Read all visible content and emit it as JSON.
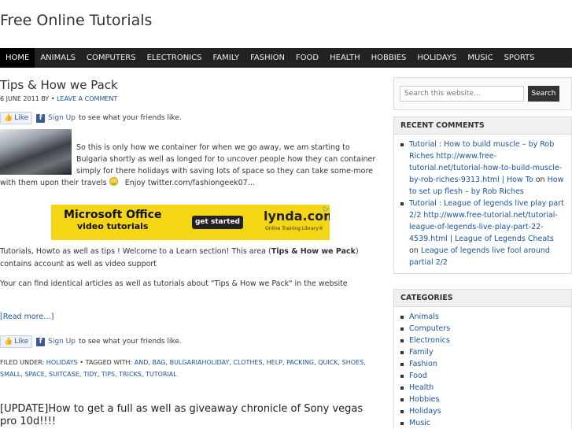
{
  "site": {
    "title": "Free Online Tutorials"
  },
  "nav": {
    "items": [
      "HOME",
      "ANIMALS",
      "COMPUTERS",
      "ELECTRONICS",
      "FAMILY",
      "FASHION",
      "FOOD",
      "HEALTH",
      "HOBBIES",
      "HOLIDAYS",
      "MUSIC",
      "SPORTS"
    ],
    "active_index": 0
  },
  "post": {
    "title": "Tips & How we Pack",
    "date": "6 June 2011",
    "by": "by",
    "author": "•",
    "leave_comment": "Leave a Comment",
    "fb": {
      "like": "Like",
      "signup": "Sign Up",
      "text": "to see what your friends like."
    },
    "intro": "So this is only how we container for when we go away, we am starting to Bulgaria shortly as well as longed for to uncover people how they can container simply for there holidays with saving lots of space so they can take some-more with them upon their travels",
    "intro_end": "Enjoy twitter.com/fashiongeek07…",
    "ad": {
      "line1": "Microsoft Office",
      "line2": "video tutorials",
      "button": "get started",
      "brand": "lynda.com",
      "tagline": "Online Training Library®"
    },
    "p1_before": "Tutorials, Howto as well as tips ! Welcome to a Learn section! This area (",
    "p1_bold": "Tips & How we Pack",
    "p1_after": ") contains account as well as video support",
    "p2": "Your can find identical articles as well as tutorials about \"Tips & How we Pack\" in the website",
    "read_more": "[Read more…]",
    "filed_label": "Filed Under:",
    "filed_category": "Holidays",
    "tagged_label": "Tagged With:",
    "tags": [
      "and",
      "bag",
      "bulgariaholiday",
      "clothes",
      "help",
      "packing",
      "quick",
      "shoes",
      "small",
      "space",
      "suitcase",
      "tidy",
      "tips",
      "tricks",
      "tutorial"
    ]
  },
  "post2": {
    "title": "[UPDATE]How to get a full as well as giveaway chronicle of Sony vegas pro 10d!!!!"
  },
  "sidebar": {
    "search": {
      "placeholder": "Search this website…",
      "button": "Search"
    },
    "recent_comments": {
      "title": "Recent Comments",
      "items": [
        {
          "author": "Tutorial : How to build muscle – by Rob Riches http://www.free-tutorial.net/tutorial-how-to-build-muscle-by-rob-riches-9313.html | How To",
          "on": "on",
          "post": "How to set up flesh – by Rob Riches"
        },
        {
          "author": "Tutorial : League of legends live play part 2/2 http://www.free-tutorial.net/tutorial-league-of-legends-live-play-part-22-4539.html | League of Legends Cheats",
          "on": "on",
          "post": "League of legends live fool around partial 2/2"
        }
      ]
    },
    "categories": {
      "title": "Categories",
      "items": [
        "Animals",
        "Computers",
        "Electronics",
        "Family",
        "Fashion",
        "Food",
        "Health",
        "Hobbies",
        "Holidays",
        "Music"
      ]
    }
  }
}
